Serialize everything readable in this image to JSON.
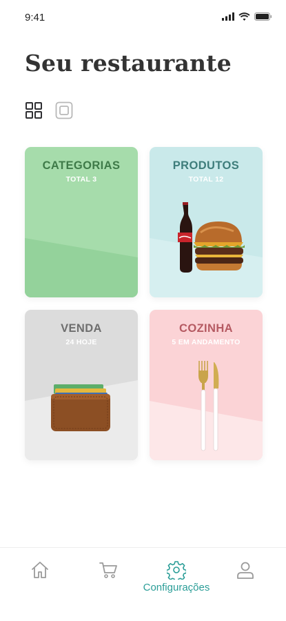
{
  "status_bar": {
    "time": "9:41"
  },
  "header": {
    "title": "Seu restaurante"
  },
  "cards": [
    {
      "title": "CATEGORIAS",
      "subtitle": "TOTAL 3",
      "title_color": "#3e7a48",
      "bg": "#a6dcab",
      "shade": "#94d29b"
    },
    {
      "title": "PRODUTOS",
      "subtitle": "TOTAL 12",
      "title_color": "#3e7d7b",
      "bg": "#c9e9ea",
      "shade": "#d6eff0"
    },
    {
      "title": "VENDA",
      "subtitle": "24 HOJE",
      "title_color": "#6e6e6e",
      "bg": "#dcdcdc",
      "shade": "#ebebeb"
    },
    {
      "title": "COZINHA",
      "subtitle": "5 EM ANDAMENTO",
      "title_color": "#b55a62",
      "bg": "#fbd3d6",
      "shade": "#fde7e8"
    }
  ],
  "bottom_nav": {
    "items": [
      {
        "icon": "home-icon",
        "label": ""
      },
      {
        "icon": "cart-icon",
        "label": ""
      },
      {
        "icon": "gear-icon",
        "label": "Configurações",
        "active": true
      },
      {
        "icon": "user-icon",
        "label": ""
      }
    ],
    "active_color": "#2a9d97",
    "inactive_color": "#9a9a9a"
  }
}
